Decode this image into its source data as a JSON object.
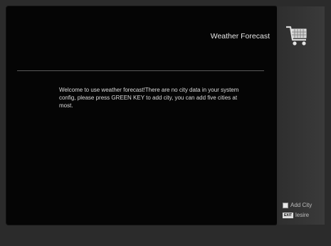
{
  "header": {
    "title": "Weather Forecast"
  },
  "icons": {
    "header_icon": "shopping-cart-icon"
  },
  "message": "Welcome to use weather forecast!There are no city data in your system config, please press GREEN KEY to add city, you can add five cities at most.",
  "legend": [
    {
      "key_icon": "white-key-icon",
      "label": "Add City"
    },
    {
      "key_icon": "exit-key-icon",
      "key_text": "EXIT",
      "label": "lesire"
    }
  ]
}
